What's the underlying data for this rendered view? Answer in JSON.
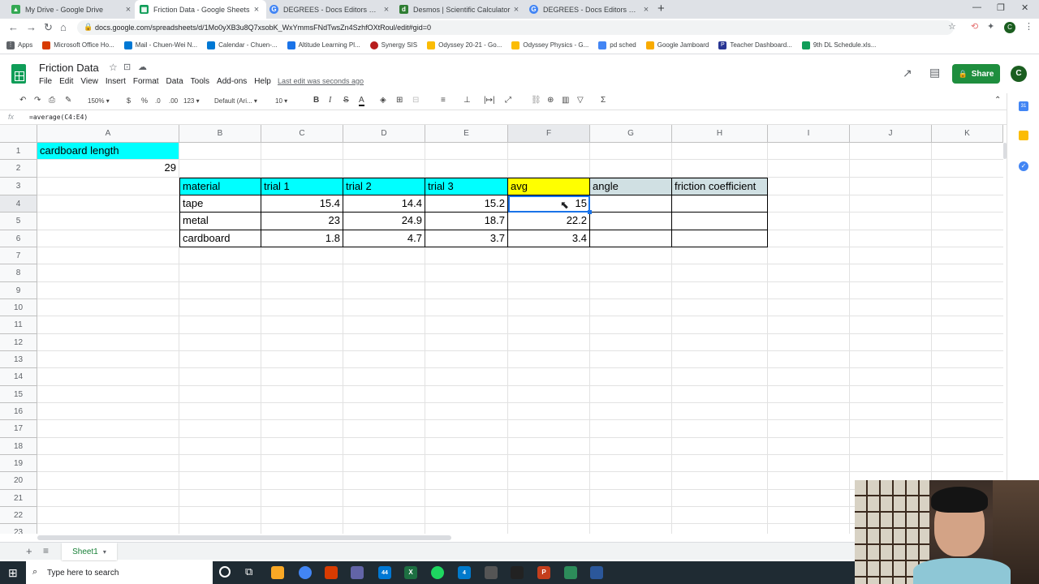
{
  "browser": {
    "tabs": [
      {
        "title": "My Drive - Google Drive",
        "icon": "drive-icon",
        "color": "#34a853",
        "active": false
      },
      {
        "title": "Friction Data - Google Sheets",
        "icon": "sheets-icon",
        "color": "#0f9d58",
        "active": true
      },
      {
        "title": "DEGREES - Docs Editors Help",
        "icon": "google-icon",
        "color": "#4285f4",
        "active": false
      },
      {
        "title": "Desmos | Scientific Calculator",
        "icon": "desmos-icon",
        "color": "#2e7d32",
        "active": false
      },
      {
        "title": "DEGREES - Docs Editors Help",
        "icon": "google-icon",
        "color": "#4285f4",
        "active": false
      }
    ],
    "url": "docs.google.com/spreadsheets/d/1Mo0yXB3u8Q7xsobK_WxYmmsFNdTwsZn4SzhfOXtRoul/edit#gid=0",
    "bookmarks": [
      {
        "label": "Apps",
        "color": "#5f6368"
      },
      {
        "label": "Microsoft Office Ho...",
        "color": "#d83b01"
      },
      {
        "label": "Mail - Chuen-Wei N...",
        "color": "#0078d4"
      },
      {
        "label": "Calendar - Chuen-...",
        "color": "#0078d4"
      },
      {
        "label": "Altitude Learning Pl...",
        "color": "#1a73e8"
      },
      {
        "label": "Synergy SIS",
        "color": "#b71c1c"
      },
      {
        "label": "Odyssey 20-21 - Go...",
        "color": "#fbbc04"
      },
      {
        "label": "Odyssey Physics - G...",
        "color": "#fbbc04"
      },
      {
        "label": "pd sched",
        "color": "#4285f4"
      },
      {
        "label": "Google Jamboard",
        "color": "#f9ab00"
      },
      {
        "label": "Teacher Dashboard...",
        "color": "#283593"
      },
      {
        "label": "9th DL Schedule.xls...",
        "color": "#0f9d58"
      }
    ]
  },
  "doc": {
    "title": "Friction Data",
    "menu": [
      "File",
      "Edit",
      "View",
      "Insert",
      "Format",
      "Data",
      "Tools",
      "Add-ons",
      "Help"
    ],
    "last_edit": "Last edit was seconds ago",
    "share_label": "Share",
    "avatar_letter": "C"
  },
  "toolbar": {
    "zoom": "150%",
    "currency": "$",
    "percent": "%",
    "dec_less": ".0",
    "dec_more": ".00",
    "format_more": "123",
    "font": "Default (Ari...",
    "font_size": "10",
    "bold": "B",
    "italic": "I",
    "strike": "S",
    "text_color": "A"
  },
  "formula": {
    "fx": "fx",
    "text": "=average(C4:E4)"
  },
  "sheet": {
    "columns": [
      "A",
      "B",
      "C",
      "D",
      "E",
      "F",
      "G",
      "H",
      "I",
      "J",
      "K"
    ],
    "rows": [
      "1",
      "2",
      "3",
      "4",
      "5",
      "6",
      "7",
      "8",
      "9",
      "10",
      "11",
      "12",
      "13",
      "14",
      "15",
      "16",
      "17",
      "18",
      "19",
      "20",
      "21",
      "22",
      "23"
    ],
    "cells": {
      "A1": "cardboard length",
      "A2": "29",
      "B3": "material",
      "C3": "trial 1",
      "D3": "trial 2",
      "E3": "trial 3",
      "F3": "avg",
      "G3": "angle",
      "H3": "friction coefficient",
      "B4": "tape",
      "C4": "15.4",
      "D4": "14.4",
      "E4": "15.2",
      "F4": "15",
      "B5": "metal",
      "C5": "23",
      "D5": "24.9",
      "E5": "18.7",
      "F5": "22.2",
      "B6": "cardboard",
      "C6": "1.8",
      "D6": "4.7",
      "E6": "3.7",
      "F6": "3.4"
    },
    "colors": {
      "cyan": "#00ffff",
      "yellow": "#ffff00",
      "gray": "#d0e0e3"
    },
    "tab_name": "Sheet1"
  },
  "taskbar": {
    "search_placeholder": "Type here to search",
    "mail_badge": "44",
    "vs_badge": "4"
  }
}
